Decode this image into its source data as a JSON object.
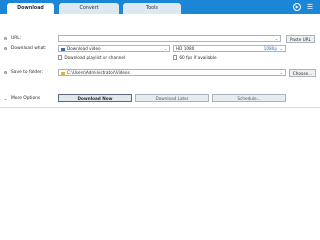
{
  "tabs": [
    {
      "label": "Download"
    },
    {
      "label": "Convert"
    },
    {
      "label": "Tools"
    }
  ],
  "url_row": {
    "label": "URL:",
    "value": "",
    "button": "Paste URL"
  },
  "download_what": {
    "label": "Download what:",
    "type_value": "Download video",
    "quality_value": "HD 1080",
    "quality_hint": "1080p",
    "option_playlist": "Download playlist or channel",
    "option_60fps": "60 fps if available"
  },
  "save_to": {
    "label": "Save to folder:",
    "path": "C:\\Users\\Administrator\\Videos",
    "button": "Choose..."
  },
  "more_options": "More Options",
  "buttons": {
    "download_now": "Download Now",
    "download_later": "Download Later",
    "schedule": "Schedule..."
  },
  "colors": {
    "accent": "#1b86d6"
  },
  "icons": {
    "play": "play-circle-icon",
    "menu": "hamburger-menu-icon"
  }
}
